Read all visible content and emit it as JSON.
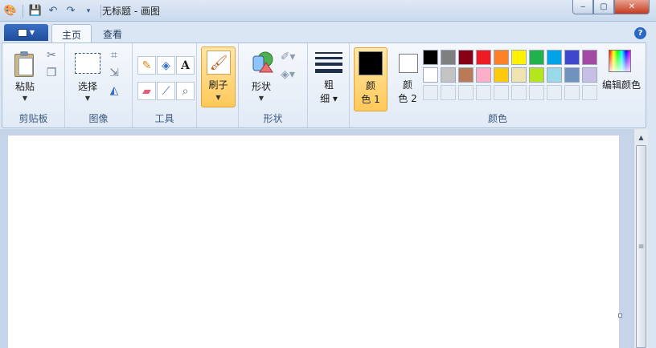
{
  "window": {
    "title": "无标题 - 画图",
    "minimize": "‒",
    "maximize": "▢",
    "close": "✕"
  },
  "tabs": {
    "home": "主页",
    "view": "查看"
  },
  "help_icon": "?",
  "clipboard": {
    "paste_label": "粘贴",
    "group_label": "剪贴板"
  },
  "image": {
    "select_label": "选择",
    "group_label": "图像"
  },
  "tools": {
    "group_label": "工具",
    "text_glyph": "A"
  },
  "brushes": {
    "label": "刷子"
  },
  "shapes": {
    "label": "形状",
    "group_label": "形状"
  },
  "size": {
    "label_line1": "粗",
    "label_line2": "细"
  },
  "colors": {
    "color1_line1": "颜",
    "color1_line2": "色 1",
    "color2_line1": "颜",
    "color2_line2": "色 2",
    "edit_colors_label": "编辑颜色",
    "group_label": "颜色",
    "color1_value": "#000000",
    "color2_value": "#ffffff",
    "palette": [
      "#000000",
      "#7f7f7f",
      "#880015",
      "#ed1c24",
      "#ff7f27",
      "#fff200",
      "#22b14c",
      "#00a2e8",
      "#3f48cc",
      "#a349a4",
      "#ffffff",
      "#c3c3c3",
      "#b97a57",
      "#ffaec9",
      "#ffc90e",
      "#efe4b0",
      "#b5e61d",
      "#99d9ea",
      "#7092be",
      "#c8bfe7"
    ]
  }
}
